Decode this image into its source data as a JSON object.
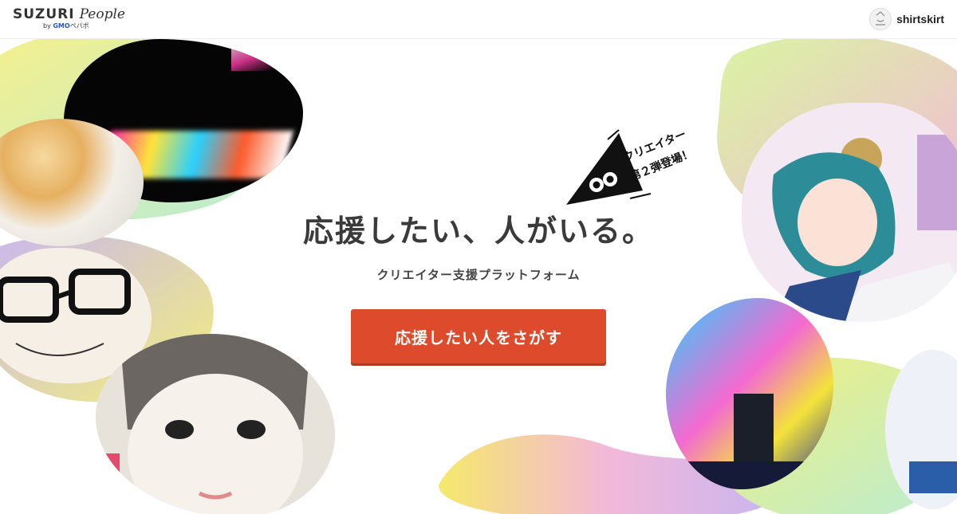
{
  "header": {
    "logo_main": "SUZURI",
    "logo_script": "People",
    "logo_by": "by",
    "logo_company": "GMO",
    "logo_company_suffix": "ペパボ",
    "user_name": "shirtskirt"
  },
  "hero": {
    "badge_line1": "クリエイター",
    "badge_line2": "第２弾登場！",
    "headline": "応援したい、人がいる。",
    "subline": "クリエイター支援プラットフォーム",
    "cta_label": "応援したい人をさがす"
  },
  "colors": {
    "accent": "#dd4a2c",
    "blob_yellow": "#eef36a",
    "blob_pink": "#f3b8d8",
    "blob_lavender": "#c9b6ef",
    "blob_mint": "#b9ecd4"
  },
  "artwork": [
    {
      "name": "art-light-sculpture"
    },
    {
      "name": "art-pudding"
    },
    {
      "name": "art-glasses-man"
    },
    {
      "name": "art-girl-portrait"
    },
    {
      "name": "art-bear-ear-girl"
    },
    {
      "name": "art-gradient-light"
    }
  ]
}
